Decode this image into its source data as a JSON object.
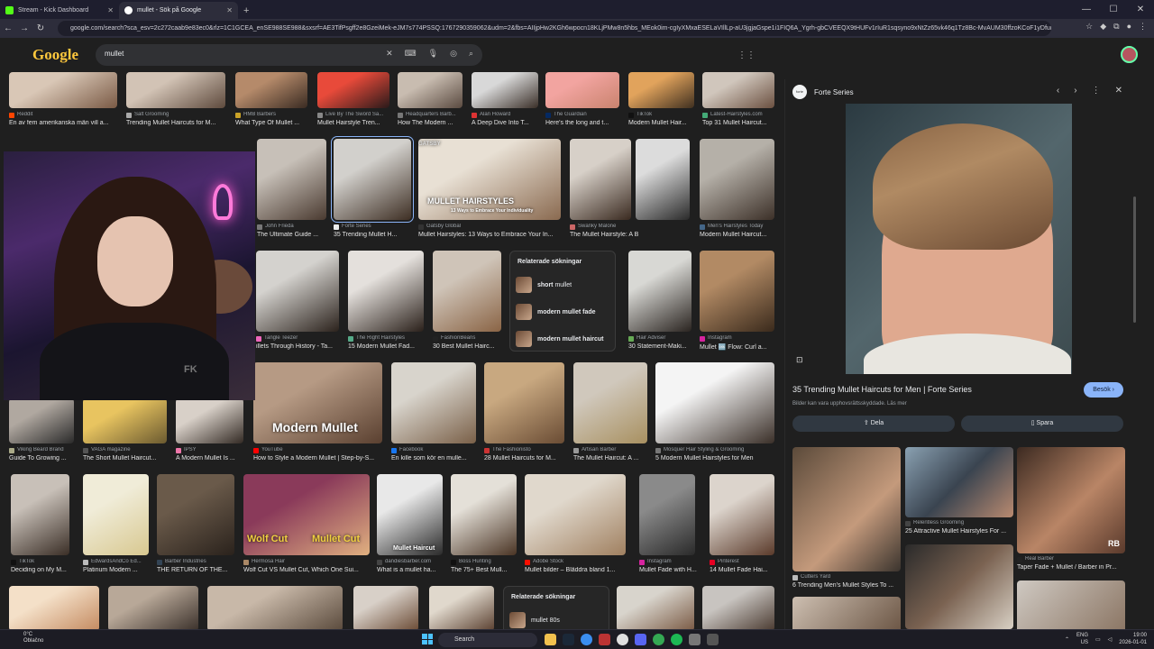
{
  "browser": {
    "tabs": [
      {
        "title": "Stream - Kick Dashboard",
        "active": false,
        "favicon_color": "#53fc18"
      },
      {
        "title": "mullet - Sök på Google",
        "active": true,
        "favicon_color": "#ffffff"
      }
    ],
    "url": "google.com/search?sca_esv=2c272caab9e83ec0&rlz=1C1GCEA_enSE988SE988&sxsrf=AE3TifPsgff2e8GzeiMek-eJM7s774PSSQ:1767290359062&udm=2&fbs=AIIjpHw2KGh6wpocn18KLjPMw8n5hbs_MEok0im-cgIyXMxaESELaVIllLp-aU3jgjaGspe1i1FIQ6A_Ygrh-gbCVEEQX9tHUFv1rIuR1sqsyno9xNtZz65vk46q1Tz8Bc-MvAUM30ffzoKCoF1yDfurCxI.Citb...",
    "nav_icons": [
      "back-icon",
      "forward-icon",
      "reload-icon"
    ]
  },
  "google": {
    "logo": "Google",
    "query": "mullet",
    "search_icons": [
      "clear-icon",
      "keyboard-icon",
      "mic-icon",
      "lens-icon",
      "search-icon"
    ]
  },
  "results": [
    {
      "source": "Reddit",
      "title": "En av fem amerikanska män vill a...",
      "fav": "#ff4500"
    },
    {
      "source": "Salt Grooming",
      "title": "Trending Mullet Haircuts for M...",
      "fav": "#aaaaaa"
    },
    {
      "source": "HMB Barbers",
      "title": "What Type Of Mullet ...",
      "fav": "#c9a227"
    },
    {
      "source": "Live By The Sword Sa...",
      "title": "Mullet Hairstyle Tren...",
      "fav": "#888888"
    },
    {
      "source": "Headquarters Barb...",
      "title": "How The Modern ...",
      "fav": "#777777"
    },
    {
      "source": "Alan Howard",
      "title": "A Deep Dive Into T...",
      "fav": "#d33"
    },
    {
      "source": "The Guardian",
      "title": "Here's the long and t...",
      "fav": "#052962"
    },
    {
      "source": "TikTok",
      "title": "Modern Mullet Hair...",
      "fav": "#111111"
    },
    {
      "source": "Latest-Hairstyles.com",
      "title": "Top 31 Mullet Haircut...",
      "fav": "#4a7"
    },
    {
      "source": "John Frieda",
      "title": "The Ultimate Guide ...",
      "fav": "#777777"
    },
    {
      "source": "Forte Series",
      "title": "35 Trending Mullet H...",
      "fav": "#eeeeee"
    },
    {
      "source": "Gatsby Global",
      "title": "Mullet Hairstyles: 13 Ways to Embrace Your In...",
      "fav": "#333333"
    },
    {
      "source": "Swanky Malone",
      "title": "The Mullet Hairstyle: A Bold Fusion of ...",
      "fav": "#c66"
    },
    {
      "source": "Men's Hairstyles Today",
      "title": "Modern Mullet Haircut...",
      "fav": "#468"
    },
    {
      "source": "Tangle Teezer",
      "title": "illets Through History - Ta...",
      "fav": "#e6b"
    },
    {
      "source": "The Right Hairstyles",
      "title": "15 Modern Mullet Fad...",
      "fav": "#5a8"
    },
    {
      "source": "FashionBeans",
      "title": "30 Best Mullet Hairc...",
      "fav": "#222"
    },
    {
      "source": "Hair Adviser",
      "title": "30 Statement-Maki...",
      "fav": "#6a5"
    },
    {
      "source": "Instagram",
      "title": "Mullet 🆒 Flow: Curl a...",
      "fav": "#d6249f"
    },
    {
      "source": "Viking Beard Brand",
      "title": "Guide To Growing ...",
      "fav": "#aa8"
    },
    {
      "source": "VAGA magazine",
      "title": "The Short Mullet Haircut...",
      "fav": "#555"
    },
    {
      "source": "IPSY",
      "title": "A Modern Mullet Is ...",
      "fav": "#e7a"
    },
    {
      "source": "YouTube",
      "title": "How to Style a Modern Mullet | Step-by-S...",
      "fav": "#ff0000"
    },
    {
      "source": "Facebook",
      "title": "En kille som kör en mulle...",
      "fav": "#1877f2"
    },
    {
      "source": "The Fashionisto",
      "title": "28 Mullet Haircuts for M...",
      "fav": "#c33"
    },
    {
      "source": "Artisan Barber",
      "title": "The Mullet Haircut: A ...",
      "fav": "#999"
    },
    {
      "source": "Mosquer Hair Styling & Grooming",
      "title": "5 Modern Mullet Hairstyles for Men",
      "fav": "#777"
    },
    {
      "source": "TikTok",
      "title": "Deciding on My M...",
      "fav": "#111111"
    },
    {
      "source": "EdwardsAndCo Ed...",
      "title": "Platinum Modern ...",
      "fav": "#bbb"
    },
    {
      "source": "Barber Industries",
      "title": "THE RETURN OF THE...",
      "fav": "#345"
    },
    {
      "source": "Hermosa Hair",
      "title": "Wolf Cut VS Mullet Cut, Which One Sui...",
      "fav": "#a86"
    },
    {
      "source": "dandiesbarber.com",
      "title": "What is a mullet ha...",
      "fav": "#444"
    },
    {
      "source": "Boss Hunting",
      "title": "The 75+ Best Mull...",
      "fav": "#111"
    },
    {
      "source": "Adobe Stock",
      "title": "Mullet bilder – Bläddra bland 1...",
      "fav": "#fa0f00"
    },
    {
      "source": "Instagram",
      "title": "Mullet Fade with H...",
      "fav": "#d6249f"
    },
    {
      "source": "Pinterest",
      "title": "14 Mullet Fade Hai...",
      "fav": "#e60023"
    }
  ],
  "overlays": {
    "mullet_hairstyles": "MULLET HAIRSTYLES",
    "mullet_sub": "13 Ways to Embrace Your Individuality",
    "modern_mullet": "Modern Mullet",
    "wolf_cut": "Wolf Cut",
    "mullet_cut": "Mullet Cut",
    "mullet_haircut": "Mullet Haircut",
    "gatsby": "GATSBY"
  },
  "related": {
    "heading": "Relaterade sökningar",
    "items": [
      {
        "bold": "short",
        "rest": " mullet"
      },
      {
        "bold": "modern mullet fade",
        "rest": ""
      },
      {
        "bold": "modern mullet haircut",
        "rest": ""
      }
    ],
    "heading2": "Relaterade sökningar",
    "items2": [
      {
        "bold": "mullet 80s",
        "rest": ""
      }
    ]
  },
  "panel": {
    "source": "Forte Series",
    "source_avatar": "forte",
    "title": "35 Trending Mullet Haircuts for Men | Forte Series",
    "note": "Bilder kan vara upphovsrättsskyddade. Läs mer",
    "visit": "Besök",
    "share": "Dela",
    "save": "Spara",
    "more": [
      {
        "source": "Cutters Yard",
        "title": "6 Trending Men's Mullet Styles To ..."
      },
      {
        "source": "Relentless Grooming",
        "title": "25 Attractive Mullet Hairstyles For ..."
      },
      {
        "source": "Real Barber",
        "title": "Taper Fade + Mullet / Barber in Pr..."
      }
    ],
    "rb_badge": "RB"
  },
  "stream": {
    "badge": "FK"
  },
  "taskbar": {
    "temp": "0°C",
    "weather": "Oblačno",
    "search": "Search",
    "lang": "ENG",
    "region": "US",
    "time": "19:00",
    "date": "2026-01-01"
  }
}
